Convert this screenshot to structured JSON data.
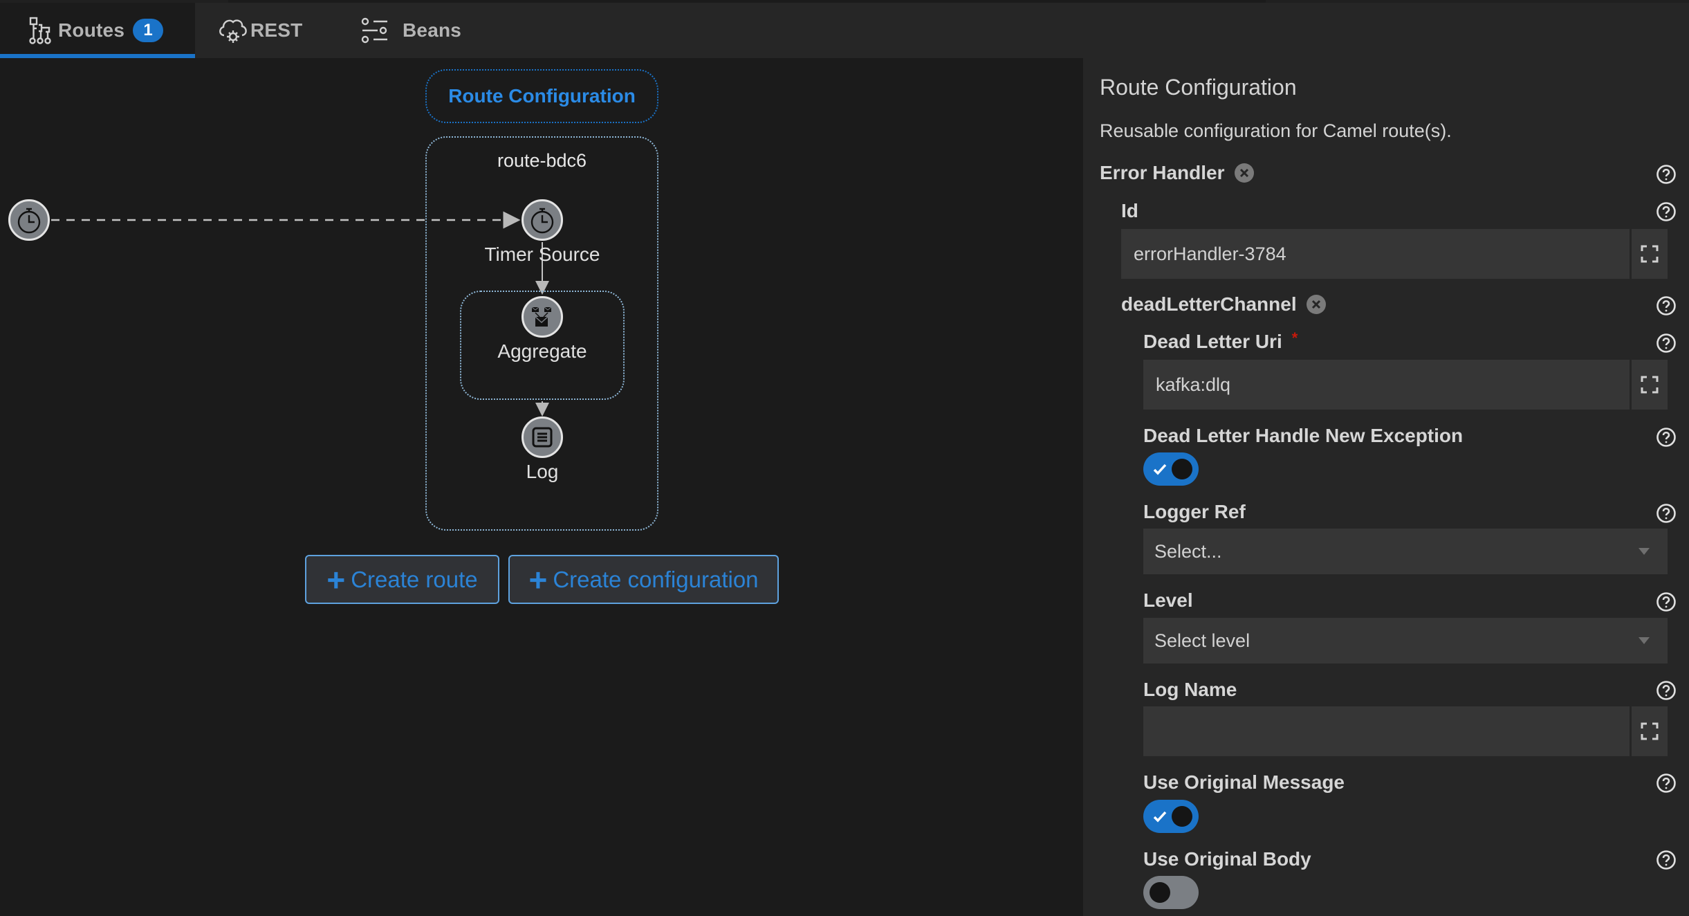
{
  "tabs": [
    {
      "label": "Routes",
      "badge": "1",
      "icon": "routes-icon",
      "active": true
    },
    {
      "label": "REST",
      "icon": "cloud-gear-icon",
      "active": false
    },
    {
      "label": "Beans",
      "icon": "sliders-icon",
      "active": false
    }
  ],
  "canvas": {
    "route_configuration_label": "Route Configuration",
    "route_id": "route-bdc6",
    "nodes": {
      "timer": {
        "label": "Timer Source",
        "icon": "timer-icon"
      },
      "aggregate": {
        "label": "Aggregate",
        "icon": "aggregate-icon"
      },
      "log": {
        "label": "Log",
        "icon": "log-icon"
      }
    },
    "buttons": {
      "create_route": "Create route",
      "create_configuration": "Create configuration"
    }
  },
  "panel": {
    "title": "Route Configuration",
    "description": "Reusable configuration for Camel route(s).",
    "error_handler": {
      "label": "Error Handler",
      "id_label": "Id",
      "id_value": "errorHandler-3784",
      "dead_letter_channel": {
        "label": "deadLetterChannel",
        "dead_letter_uri_label": "Dead Letter Uri",
        "dead_letter_uri_required": "*",
        "dead_letter_uri_value": "kafka:dlq",
        "handle_new_exception_label": "Dead Letter Handle New Exception",
        "handle_new_exception_on": true,
        "logger_ref_label": "Logger Ref",
        "logger_ref_placeholder": "Select...",
        "level_label": "Level",
        "level_placeholder": "Select level",
        "log_name_label": "Log Name",
        "log_name_value": "",
        "use_original_message_label": "Use Original Message",
        "use_original_message_on": true,
        "use_original_body_label": "Use Original Body",
        "use_original_body_on": false
      }
    }
  },
  "colors": {
    "accent": "#1a73c8",
    "link_blue": "#2b83d6",
    "canvas_bg": "#1b1b1b",
    "panel_bg": "#262626",
    "input_bg": "#363636",
    "required": "#c9190b"
  }
}
